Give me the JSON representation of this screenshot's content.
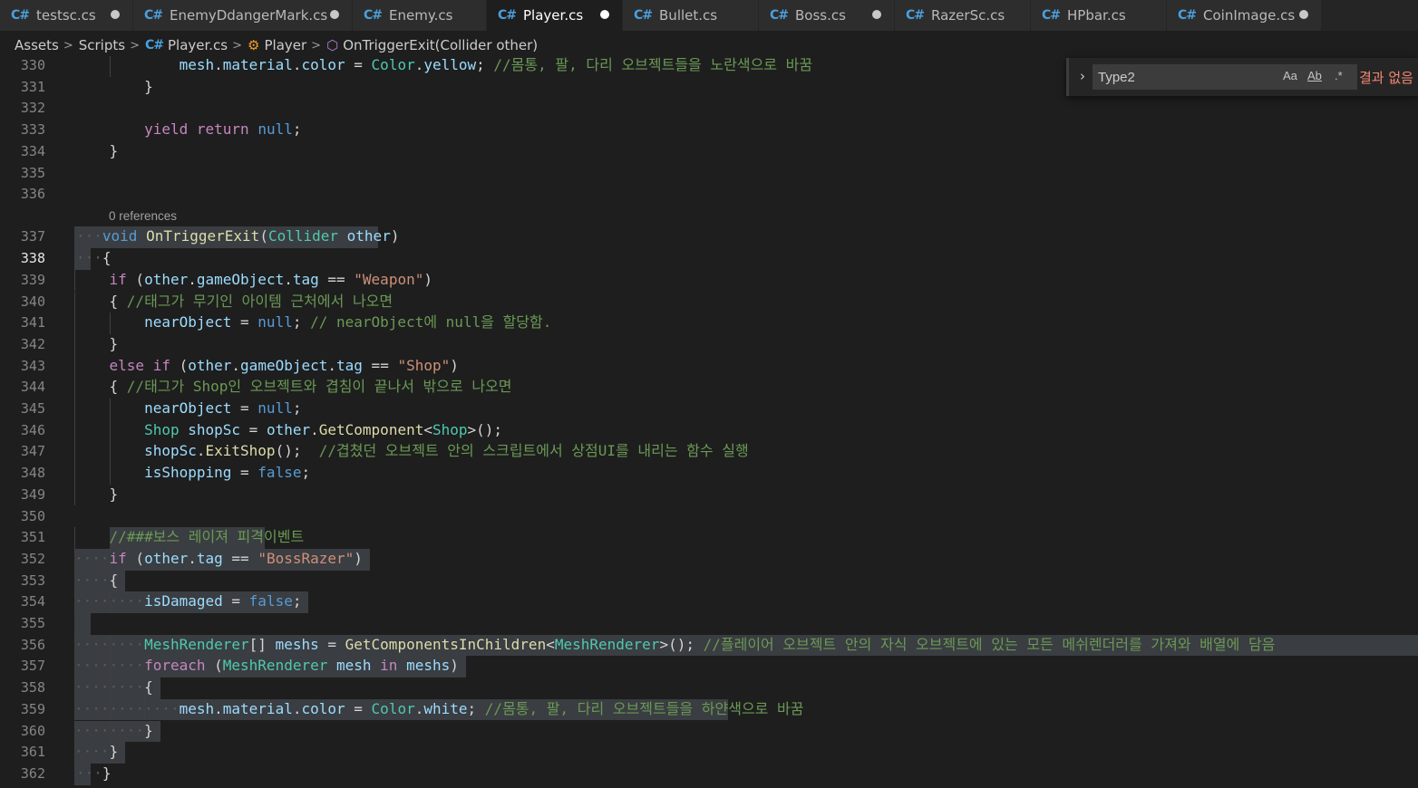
{
  "tabs": [
    {
      "label": "testsc.cs",
      "modified": true,
      "active": false
    },
    {
      "label": "EnemyDdangerMark.cs",
      "modified": true,
      "active": false
    },
    {
      "label": "Enemy.cs",
      "modified": false,
      "active": false
    },
    {
      "label": "Player.cs",
      "modified": true,
      "active": true
    },
    {
      "label": "Bullet.cs",
      "modified": false,
      "active": false
    },
    {
      "label": "Boss.cs",
      "modified": true,
      "active": false
    },
    {
      "label": "RazerSc.cs",
      "modified": false,
      "active": false
    },
    {
      "label": "HPbar.cs",
      "modified": false,
      "active": false
    },
    {
      "label": "CoinImage.cs",
      "modified": true,
      "active": false
    }
  ],
  "breadcrumb": {
    "items": [
      "Assets",
      "Scripts",
      "Player.cs",
      "Player",
      "OnTriggerExit(Collider other)"
    ],
    "separator": ">"
  },
  "codelens": "0 references",
  "find": {
    "value": "Type2",
    "match_case": "Aa",
    "whole_word": "Ab",
    "regex": ".*",
    "result": "결과 없음"
  },
  "editor": {
    "current_line": 338,
    "lines": [
      {
        "n": 330,
        "code": "        mesh.material.color = Color.yellow; //몸통, 팔, 다리 오브젝트들을 노란색으로 바꿈"
      },
      {
        "n": 331,
        "code": "    }"
      },
      {
        "n": 332,
        "code": ""
      },
      {
        "n": 333,
        "code": "    yield return null;"
      },
      {
        "n": 334,
        "code": "}"
      },
      {
        "n": 335,
        "code": ""
      },
      {
        "n": 336,
        "code": ""
      },
      {
        "n": 337,
        "code": "void OnTriggerExit(Collider other)"
      },
      {
        "n": 338,
        "code": "{"
      },
      {
        "n": 339,
        "code": "    if (other.gameObject.tag == \"Weapon\")"
      },
      {
        "n": 340,
        "code": "    { //태그가 무기인 아이템 근처에서 나오면"
      },
      {
        "n": 341,
        "code": "        nearObject = null; // nearObject에 null을 할당함."
      },
      {
        "n": 342,
        "code": "    }"
      },
      {
        "n": 343,
        "code": "    else if (other.gameObject.tag == \"Shop\")"
      },
      {
        "n": 344,
        "code": "    { //태그가 Shop인 오브젝트와 겹침이 끝나서 밖으로 나오면"
      },
      {
        "n": 345,
        "code": "        nearObject = null;"
      },
      {
        "n": 346,
        "code": "        Shop shopSc = other.GetComponent<Shop>();"
      },
      {
        "n": 347,
        "code": "        shopSc.ExitShop();  //겹쳤던 오브젝트 안의 스크립트에서 상점UI를 내리는 함수 실행"
      },
      {
        "n": 348,
        "code": "        isShopping = false;"
      },
      {
        "n": 349,
        "code": "    }"
      },
      {
        "n": 350,
        "code": ""
      },
      {
        "n": 351,
        "code": "    //###보스 레이져 피격이벤트"
      },
      {
        "n": 352,
        "code": "    if (other.tag == \"BossRazer\")"
      },
      {
        "n": 353,
        "code": "    {"
      },
      {
        "n": 354,
        "code": "        isDamaged = false;"
      },
      {
        "n": 355,
        "code": ""
      },
      {
        "n": 356,
        "code": "        MeshRenderer[] meshs = GetComponentsInChildren<MeshRenderer>(); //플레이어 오브젝트 안의 자식 오브젝트에 있는 모든 메쉬렌더러를 가져와 배열에 담음"
      },
      {
        "n": 357,
        "code": "        foreach (MeshRenderer mesh in meshs)"
      },
      {
        "n": 358,
        "code": "        {"
      },
      {
        "n": 359,
        "code": "            mesh.material.color = Color.white; //몸통, 팔, 다리 오브젝트들을 하얀색으로 바꿈"
      },
      {
        "n": 360,
        "code": "        }"
      },
      {
        "n": 361,
        "code": "    }"
      },
      {
        "n": 362,
        "code": "}"
      }
    ]
  }
}
